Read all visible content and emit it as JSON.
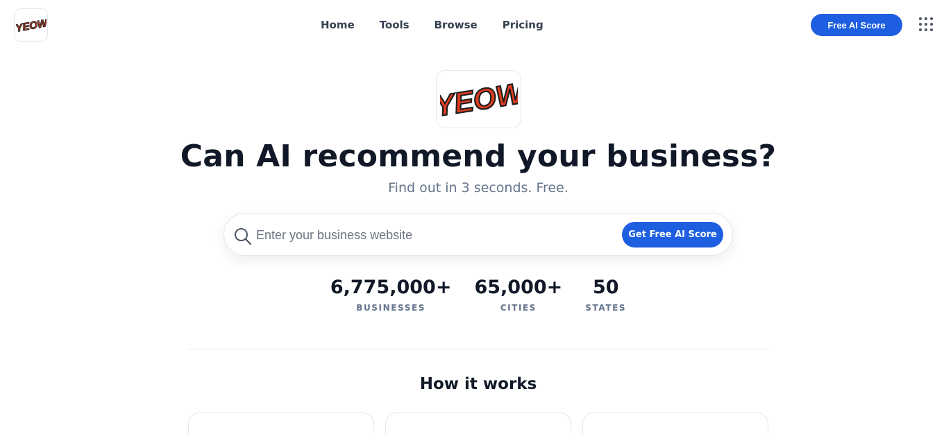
{
  "header": {
    "logo_text": "YEOW",
    "nav": [
      {
        "label": "Home"
      },
      {
        "label": "Tools"
      },
      {
        "label": "Browse"
      },
      {
        "label": "Pricing"
      }
    ],
    "cta_label": "Free AI Score",
    "apps_icon": "grid-dots-icon"
  },
  "hero": {
    "logo_text": "YEOW",
    "headline": "Can AI recommend your business?",
    "subheadline": "Find out in 3 seconds. Free."
  },
  "search": {
    "icon": "search-icon",
    "placeholder": "Enter your business website",
    "value": "",
    "button_label": "Get Free AI Score"
  },
  "stats": [
    {
      "value": "6,775,000+",
      "label": "BUSINESSES"
    },
    {
      "value": "65,000+",
      "label": "CITIES"
    },
    {
      "value": "50",
      "label": "STATES"
    }
  ],
  "how_it_works": {
    "title": "How it works"
  },
  "colors": {
    "accent": "#1d5fe0",
    "logo_red": "#e23c1e",
    "text": "#111827",
    "muted": "#64748b"
  }
}
